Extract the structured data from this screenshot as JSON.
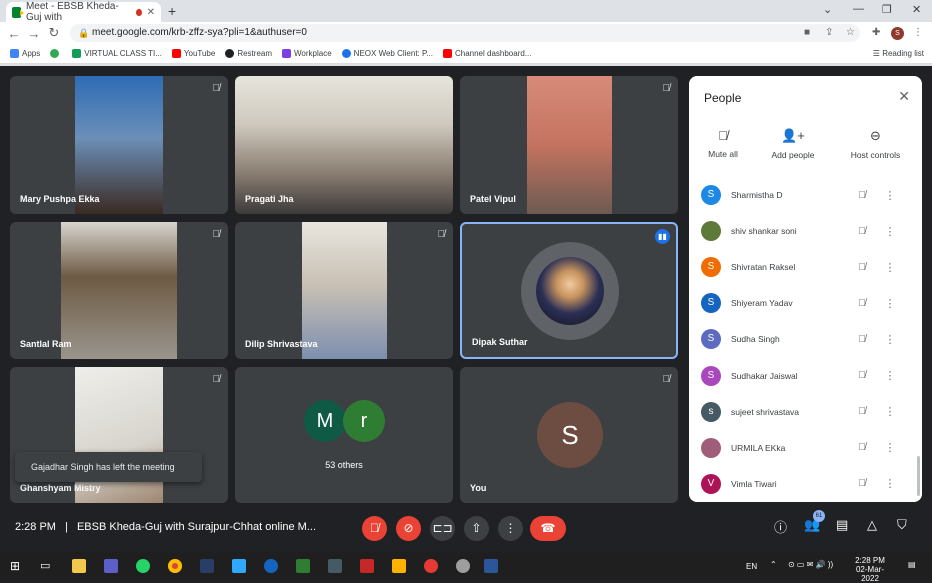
{
  "browser": {
    "tab_title": "Meet - EBSB Kheda-Guj with",
    "url": "meet.google.com/krb-zffz-sya?pli=1&authuser=0",
    "profile_initial": "S",
    "bookmarks": [
      {
        "label": "Apps",
        "color": "#4285f4"
      },
      {
        "label": "",
        "color": "#34a853"
      },
      {
        "label": "VIRTUAL CLASS TI...",
        "color": "#0f9d58"
      },
      {
        "label": "YouTube",
        "color": "#ff0000"
      },
      {
        "label": "Restream",
        "color": "#202124"
      },
      {
        "label": "Workplace",
        "color": "#7b3fe4"
      },
      {
        "label": "NEOX Web Client: P...",
        "color": "#1a73e8"
      },
      {
        "label": "Channel dashboard...",
        "color": "#ff0000"
      }
    ],
    "reading_list": "Reading list"
  },
  "tiles": [
    {
      "name": "Mary Pushpa Ekka",
      "bg": "#56534f"
    },
    {
      "name": "Pragati Jha",
      "bg": "#7a7468"
    },
    {
      "name": "Patel Vipul",
      "bg": "#b56b5e"
    },
    {
      "name": "Santlal Ram",
      "bg": "#6f6a63"
    },
    {
      "name": "Dilip Shrivastava",
      "bg": "#8e8a85"
    },
    {
      "name": "Dipak Suthar",
      "initial": "",
      "bg": "#3c4043"
    },
    {
      "name": "Ghanshyam Mistry",
      "bg": "#b9b7b2"
    },
    {
      "name": "53 others",
      "avatars": [
        "M",
        "r"
      ],
      "bg": "#3c4043"
    },
    {
      "name": "You",
      "initial": "S",
      "bg": "#3c4043"
    }
  ],
  "toast": "Gajadhar Singh has left the meeting",
  "people_panel": {
    "title": "People",
    "actions": [
      {
        "label": "Mute all",
        "icon": "mic-off-icon"
      },
      {
        "label": "Add people",
        "icon": "add-person-icon"
      },
      {
        "label": "Host controls",
        "icon": "toggle-icon"
      }
    ],
    "participants": [
      {
        "name": "Sharmistha D",
        "initial": "S",
        "color": "#1e88e5"
      },
      {
        "name": "shiv shankar soni",
        "initial": "",
        "color": "#5d7a3a"
      },
      {
        "name": "Shivratan Raksel",
        "initial": "S",
        "color": "#ef6c00"
      },
      {
        "name": "Shiyeram Yadav",
        "initial": "S",
        "color": "#1565c0"
      },
      {
        "name": "Sudha Singh",
        "initial": "S",
        "color": "#5c6bc0"
      },
      {
        "name": "Sudhakar Jaiswal",
        "initial": "S",
        "color": "#ab47bc"
      },
      {
        "name": "sujeet shrivastava",
        "initial": "s",
        "color": "#455a64"
      },
      {
        "name": "URMILA EKka",
        "initial": "",
        "color": "#a05d7a"
      },
      {
        "name": "Vimla Tiwari",
        "initial": "V",
        "color": "#ad1457"
      }
    ]
  },
  "bottom": {
    "time": "2:28 PM",
    "separator": "|",
    "meeting_title": "EBSB Kheda-Guj with Surajpur-Chhat online M...",
    "people_count": "61"
  },
  "taskbar": {
    "lang": "EN",
    "clock_time": "2:28 PM",
    "clock_date": "02-Mar-2022"
  }
}
